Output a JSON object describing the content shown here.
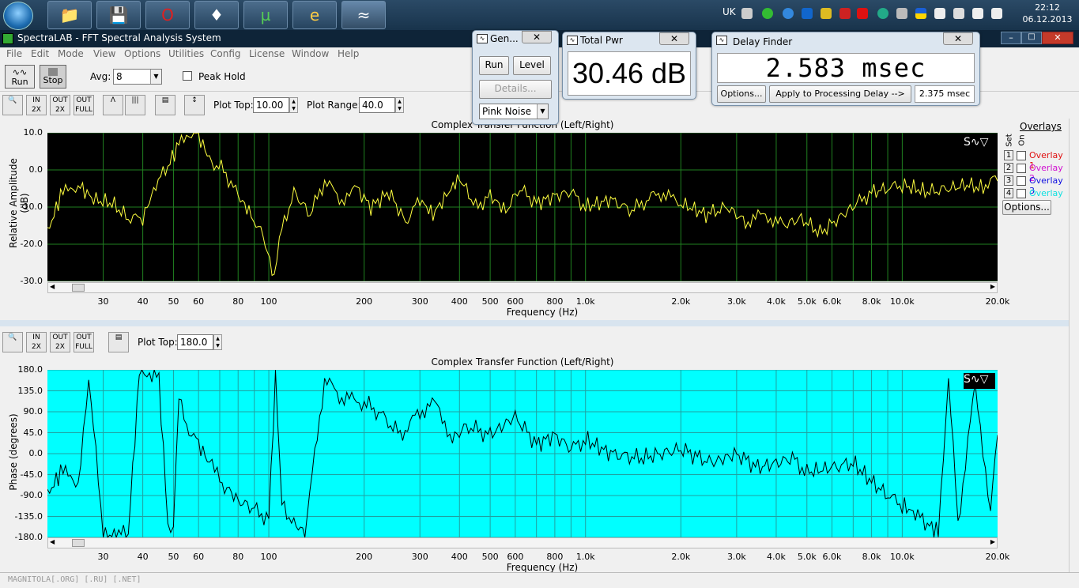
{
  "taskbar": {
    "clock_time": "22:12",
    "clock_date": "06.12.2013",
    "lang": "UK"
  },
  "window": {
    "title": "SpectraLAB - FFT Spectral Analysis System"
  },
  "menu": [
    "File",
    "Edit",
    "Mode",
    "View",
    "Options",
    "Utilities",
    "Config",
    "License",
    "Window",
    "Help"
  ],
  "toolbar": {
    "run_label": "Run",
    "stop_label": "Stop",
    "avg_label": "Avg:",
    "avg_value": "8",
    "peak_hold_label": "Peak Hold"
  },
  "plot1_toolbar": {
    "plot_top_label": "Plot Top:",
    "plot_top_value": "10.00",
    "plot_range_label": "Plot Range:",
    "plot_range_value": "40.0"
  },
  "plot2_toolbar": {
    "plot_top_label": "Plot Top:",
    "plot_top_value": "180.0"
  },
  "overlays": {
    "title": "Overlays",
    "set_label": "Set",
    "on_label": "On",
    "items": [
      {
        "num": "1",
        "label": "Overlay 1",
        "color": "#e01010"
      },
      {
        "num": "2",
        "label": "Overlay 2",
        "color": "#d010d0"
      },
      {
        "num": "3",
        "label": "Overlay 3",
        "color": "#1010e0"
      },
      {
        "num": "4",
        "label": "Overlay 4",
        "color": "#10e0e0"
      }
    ],
    "options_label": "Options..."
  },
  "generator": {
    "title": "Gen...",
    "run_label": "Run",
    "level_label": "Level",
    "details_label": "Details...",
    "signal": "Pink Noise"
  },
  "total_pwr": {
    "title": "Total Pwr",
    "value": "30.46 dB"
  },
  "delay_finder": {
    "title": "Delay Finder",
    "value": "2.583 msec",
    "options_label": "Options...",
    "apply_label": "Apply to Processing Delay -->",
    "delay_value": "2.375 msec"
  },
  "watermark": "MAGNITOLA[.ORG] [.RU] [.NET]",
  "chart_data": [
    {
      "type": "line",
      "title": "Complex Transfer Function (Left/Right)",
      "xlabel": "Frequency (Hz)",
      "ylabel": "Relative Amplitude (dB)",
      "xscale": "log",
      "xlim": [
        20,
        20000
      ],
      "ylim": [
        -30,
        10
      ],
      "yticks": [
        "10.0",
        "0.0",
        "-10.0",
        "-20.0",
        "-30.0"
      ],
      "xticks": [
        "30",
        "40",
        "50",
        "60",
        "80",
        "100",
        "200",
        "300",
        "400",
        "500",
        "600",
        "800",
        "1.0k",
        "2.0k",
        "3.0k",
        "4.0k",
        "5.0k",
        "6.0k",
        "8.0k",
        "10.0k",
        "20.0k"
      ],
      "xtick_values": [
        30,
        40,
        50,
        60,
        80,
        100,
        200,
        300,
        400,
        500,
        600,
        800,
        1000,
        2000,
        3000,
        4000,
        5000,
        6000,
        8000,
        10000,
        20000
      ],
      "background": "#000000",
      "line_color": "#ffff40",
      "grid_color": "#208020",
      "x": [
        20,
        22,
        25,
        28,
        32,
        36,
        40,
        44,
        48,
        52,
        56,
        60,
        66,
        72,
        80,
        88,
        96,
        104,
        110,
        120,
        135,
        150,
        170,
        190,
        210,
        240,
        270,
        300,
        330,
        370,
        400,
        450,
        500,
        560,
        620,
        700,
        800,
        900,
        1000,
        1200,
        1400,
        1700,
        2000,
        2400,
        2800,
        3200,
        3700,
        4200,
        4800,
        5500,
        6300,
        7200,
        8000,
        9000,
        10000,
        12000,
        14000,
        16000,
        18000,
        19000,
        20000
      ],
      "y": [
        -17,
        -7,
        -4,
        -8,
        -9,
        -13,
        -13,
        -4,
        1,
        7,
        10,
        9,
        2,
        0,
        -7,
        -12,
        -18,
        -29,
        -16,
        -6,
        -12,
        -3,
        -8,
        -5,
        -10,
        -6,
        -14,
        -8,
        -12,
        -6,
        -2,
        -10,
        -7,
        -11,
        -5,
        -9,
        -7,
        -6,
        -10,
        -8,
        -11,
        -6,
        -9,
        -12,
        -10,
        -14,
        -12,
        -15,
        -13,
        -17,
        -13,
        -9,
        -6,
        -5,
        -4,
        -6,
        -5,
        -4,
        -5,
        -2,
        -3
      ]
    },
    {
      "type": "line",
      "title": "Complex Transfer Function (Left/Right)",
      "xlabel": "Frequency (Hz)",
      "ylabel": "Phase (degrees)",
      "xscale": "log",
      "xlim": [
        20,
        20000
      ],
      "ylim": [
        -180,
        180
      ],
      "yticks": [
        "180.0",
        "135.0",
        "90.0",
        "45.0",
        "0.0",
        "-45.0",
        "-90.0",
        "-135.0",
        "-180.0"
      ],
      "xticks": [
        "30",
        "40",
        "50",
        "60",
        "80",
        "100",
        "200",
        "300",
        "400",
        "500",
        "600",
        "800",
        "1.0k",
        "2.0k",
        "3.0k",
        "4.0k",
        "5.0k",
        "6.0k",
        "8.0k",
        "10.0k",
        "20.0k"
      ],
      "xtick_values": [
        30,
        40,
        50,
        60,
        80,
        100,
        200,
        300,
        400,
        500,
        600,
        800,
        1000,
        2000,
        3000,
        4000,
        5000,
        6000,
        8000,
        10000,
        20000
      ],
      "background": "#00ffff",
      "line_color": "#000000",
      "grid_color": "#20a0a0",
      "x": [
        20,
        22,
        25,
        27,
        30,
        33,
        36,
        39,
        42,
        45,
        48,
        50,
        52,
        55,
        60,
        65,
        70,
        75,
        80,
        90,
        100,
        105,
        110,
        120,
        130,
        150,
        170,
        200,
        230,
        260,
        300,
        340,
        380,
        420,
        500,
        600,
        700,
        800,
        900,
        1000,
        1200,
        1500,
        2000,
        2500,
        3000,
        3500,
        4000,
        4500,
        5000,
        6000,
        7000,
        8000,
        9000,
        10000,
        11000,
        12000,
        13000,
        14000,
        15000,
        17000,
        19000,
        20000
      ],
      "y": [
        -90,
        -40,
        -60,
        170,
        -175,
        -175,
        -170,
        170,
        175,
        160,
        -150,
        -160,
        120,
        60,
        20,
        -20,
        -60,
        -80,
        -100,
        -120,
        -140,
        170,
        -110,
        -150,
        -170,
        160,
        120,
        110,
        80,
        40,
        90,
        110,
        30,
        60,
        40,
        80,
        20,
        40,
        10,
        30,
        0,
        -10,
        10,
        -20,
        0,
        -30,
        -20,
        -10,
        -40,
        -30,
        -20,
        -60,
        -90,
        -110,
        -130,
        -150,
        -170,
        170,
        -150,
        150,
        -120,
        40
      ]
    }
  ]
}
